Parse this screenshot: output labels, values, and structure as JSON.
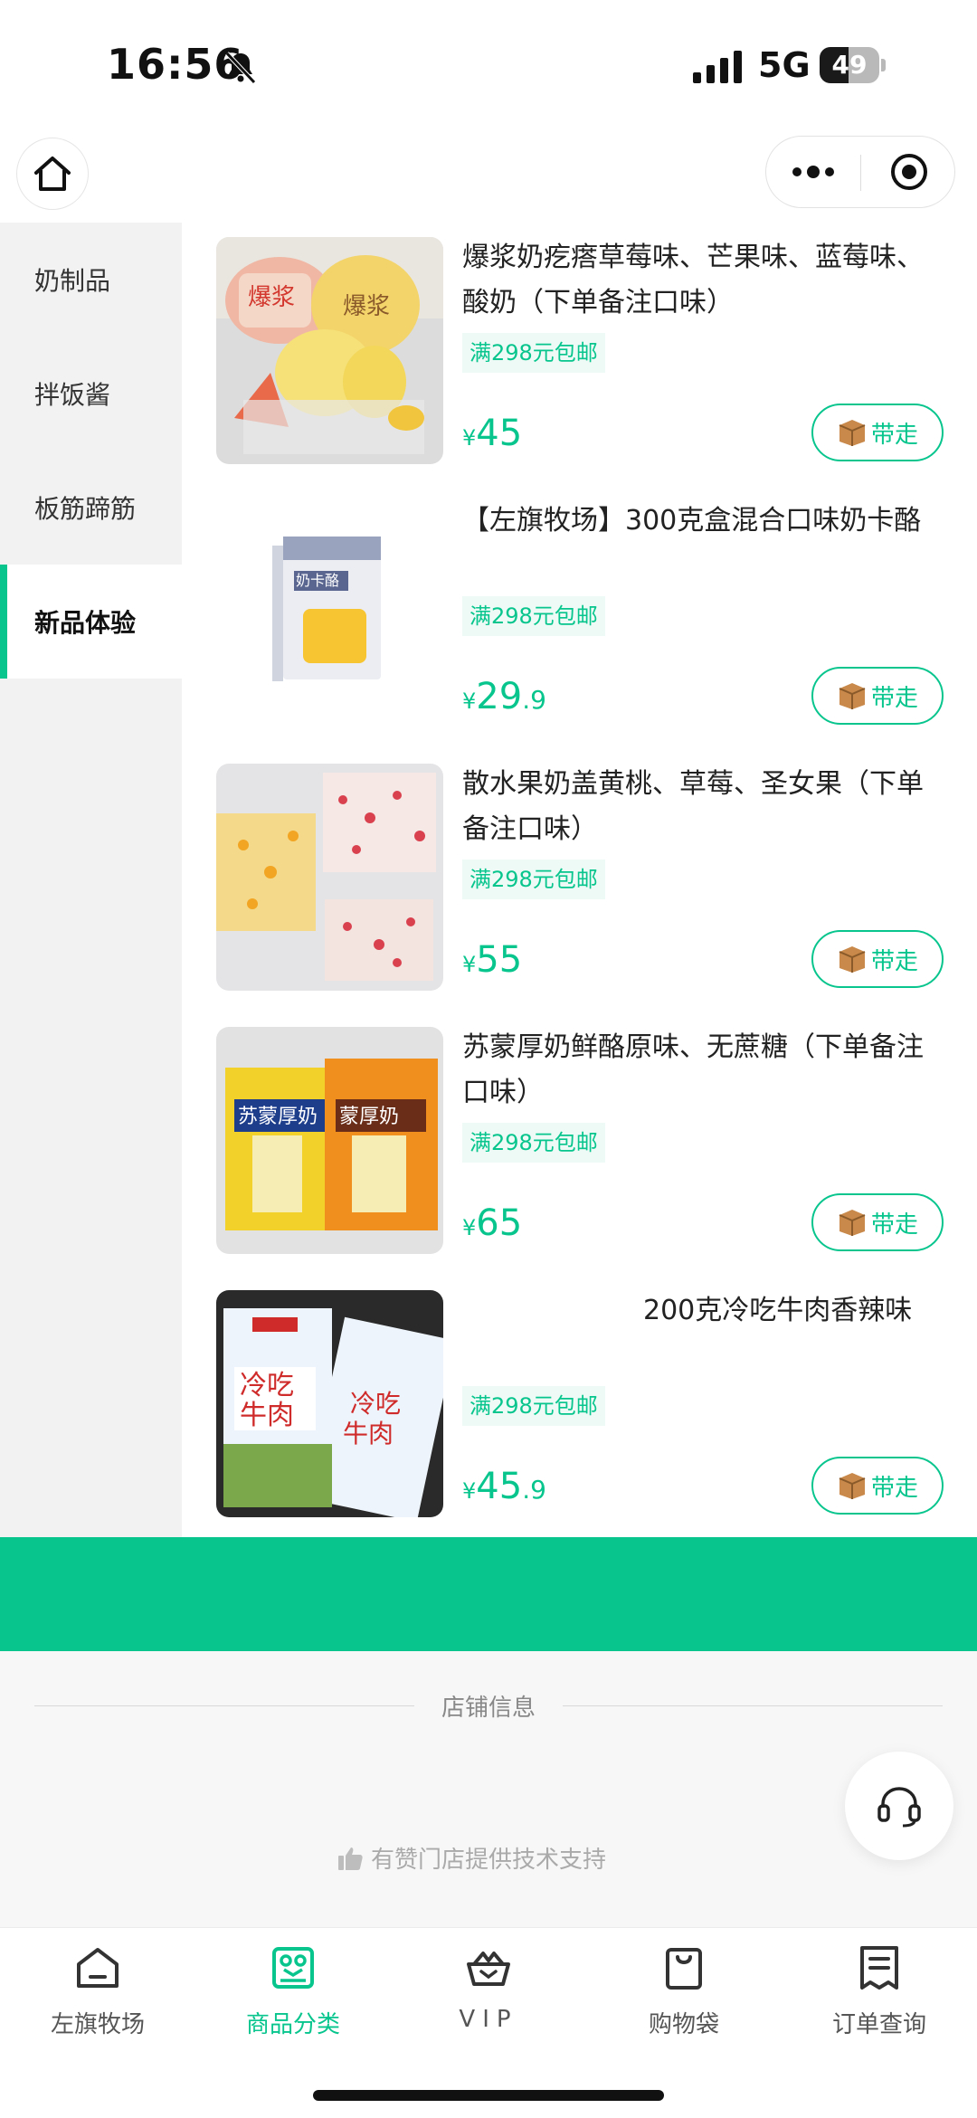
{
  "status_bar": {
    "time": "16:56",
    "network": "5G",
    "battery": "49",
    "battery_level": 0.49
  },
  "header": {
    "home_icon": "home-icon",
    "more_icon": "more-icon",
    "close_icon": "target-close-icon"
  },
  "sidebar": {
    "items": [
      {
        "label": "奶制品",
        "active": false
      },
      {
        "label": "拌饭酱",
        "active": false
      },
      {
        "label": "板筋蹄筋",
        "active": false
      },
      {
        "label": "新品体验",
        "active": true
      }
    ]
  },
  "products": [
    {
      "name": "爆浆奶疙瘩草莓味、芒果味、蓝莓味、酸奶（下单备注口味）",
      "shipping": "满298元包邮",
      "currency": "¥",
      "price_int": "45",
      "price_dec": "",
      "button": "带走",
      "button_icon": "package-icon"
    },
    {
      "name": "【左旗牧场】300克盒混合口味奶卡酪",
      "shipping": "满298元包邮",
      "currency": "¥",
      "price_int": "29",
      "price_dec": ".9",
      "button": "带走",
      "button_icon": "package-icon"
    },
    {
      "name": "散水果奶盖黄桃、草莓、圣女果（下单备注口味）",
      "shipping": "满298元包邮",
      "currency": "¥",
      "price_int": "55",
      "price_dec": "",
      "button": "带走",
      "button_icon": "package-icon"
    },
    {
      "name": "苏蒙厚奶鲜酪原味、无蔗糖（下单备注口味）",
      "shipping": "满298元包邮",
      "currency": "¥",
      "price_int": "65",
      "price_dec": "",
      "button": "带走",
      "button_icon": "package-icon"
    },
    {
      "name": "200克冷吃牛肉香辣味",
      "shipping": "满298元包邮",
      "currency": "¥",
      "price_int": "45",
      "price_dec": ".9",
      "button": "带走",
      "button_icon": "package-icon"
    }
  ],
  "footer": {
    "store_info": "店铺信息",
    "support": "有赞门店提供技术支持",
    "support_icon": "thumbs-up-icon",
    "cs_icon": "headset-icon"
  },
  "tabbar": {
    "items": [
      {
        "label": "左旗牧场",
        "icon": "home-icon",
        "active": false
      },
      {
        "label": "商品分类",
        "icon": "category-icon",
        "active": true
      },
      {
        "label": "VIP",
        "icon": "vip-basket-icon",
        "active": false
      },
      {
        "label": "购物袋",
        "icon": "shopping-bag-icon",
        "active": false
      },
      {
        "label": "订单查询",
        "icon": "order-list-icon",
        "active": false
      }
    ]
  },
  "colors": {
    "accent": "#07c58d",
    "sidebar_bg": "#f2f2f2",
    "footer_bg": "#f7f7f7"
  }
}
